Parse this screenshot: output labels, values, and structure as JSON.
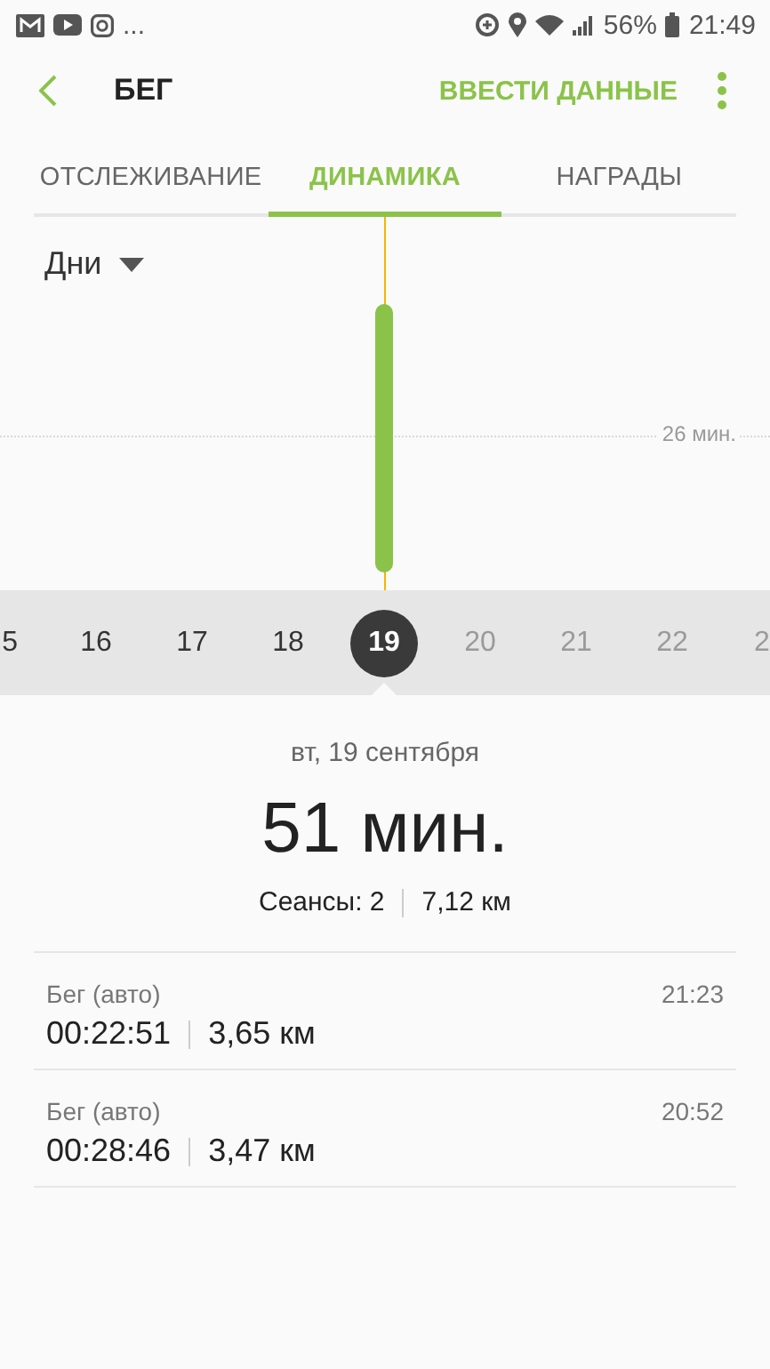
{
  "status_bar": {
    "more": "...",
    "battery": "56%",
    "time": "21:49"
  },
  "header": {
    "title": "БЕГ",
    "action": "ВВЕСТИ ДАННЫЕ"
  },
  "tabs": [
    {
      "label": "ОТСЛЕЖИВАНИЕ",
      "selected": false
    },
    {
      "label": "ДИНАМИКА",
      "selected": true
    },
    {
      "label": "НАГРАДЫ",
      "selected": false
    }
  ],
  "chart": {
    "period": "Дни",
    "gridline_label": "26 мин."
  },
  "days": [
    {
      "label": "5",
      "selected": false,
      "future": false
    },
    {
      "label": "16",
      "selected": false,
      "future": false
    },
    {
      "label": "17",
      "selected": false,
      "future": false
    },
    {
      "label": "18",
      "selected": false,
      "future": false
    },
    {
      "label": "19",
      "selected": true,
      "future": false
    },
    {
      "label": "20",
      "selected": false,
      "future": true
    },
    {
      "label": "21",
      "selected": false,
      "future": true
    },
    {
      "label": "22",
      "selected": false,
      "future": true
    },
    {
      "label": "2",
      "selected": false,
      "future": true
    }
  ],
  "summary": {
    "date": "вт, 19 сентября",
    "total": "51 мин.",
    "sessions": "Сеансы: 2",
    "distance": "7,12 км"
  },
  "sessions": [
    {
      "name": "Бег (авто)",
      "time": "21:23",
      "duration": "00:22:51",
      "distance": "3,65 км"
    },
    {
      "name": "Бег (авто)",
      "time": "20:52",
      "duration": "00:28:46",
      "distance": "3,47 км"
    }
  ]
}
